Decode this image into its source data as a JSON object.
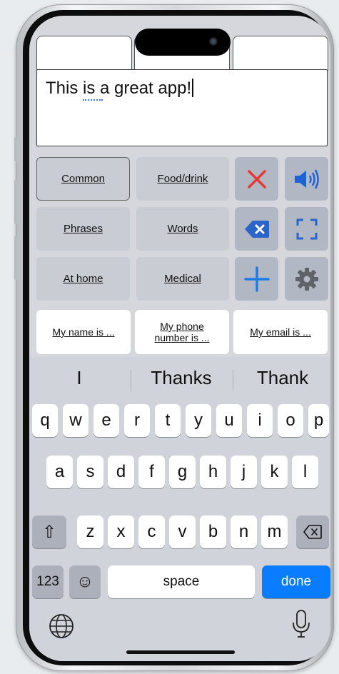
{
  "status": {
    "time": "",
    "indicators": ""
  },
  "text_area": {
    "text": "This is a great app!"
  },
  "categories": [
    {
      "label": "Common",
      "selected": true
    },
    {
      "label": "Food/drink",
      "selected": false
    },
    {
      "label": "Phrases",
      "selected": false
    },
    {
      "label": "Words",
      "selected": false
    },
    {
      "label": "At home",
      "selected": false
    },
    {
      "label": "Medical",
      "selected": false
    }
  ],
  "actions": {
    "clear": {
      "icon": "x-icon",
      "color": "#e53935"
    },
    "speak": {
      "icon": "speaker-icon",
      "color": "#1e63d6"
    },
    "backspace": {
      "icon": "backspace-icon",
      "color": "#2a66c9"
    },
    "fullscreen": {
      "icon": "fullscreen-icon",
      "color": "#2a66c9"
    },
    "add": {
      "icon": "plus-icon",
      "color": "#1e7be6"
    },
    "settings": {
      "icon": "gear-icon",
      "color": "#5f6368"
    }
  },
  "phrases": [
    {
      "line1": "My name is ...",
      "line2": ""
    },
    {
      "line1": "My phone",
      "line2": "number is ..."
    },
    {
      "line1": "My email is ...",
      "line2": ""
    }
  ],
  "keyboard": {
    "suggestions": [
      "I",
      "Thanks",
      "Thank"
    ],
    "row1": [
      "q",
      "w",
      "e",
      "r",
      "t",
      "y",
      "u",
      "i",
      "o",
      "p"
    ],
    "row2": [
      "a",
      "s",
      "d",
      "f",
      "g",
      "h",
      "j",
      "k",
      "l"
    ],
    "row3": [
      "z",
      "x",
      "c",
      "v",
      "b",
      "n",
      "m"
    ],
    "shift": "⇧",
    "numbers": "123",
    "emoji": "☺",
    "space": "space",
    "done": "done",
    "done_color": "#0a7cff"
  }
}
